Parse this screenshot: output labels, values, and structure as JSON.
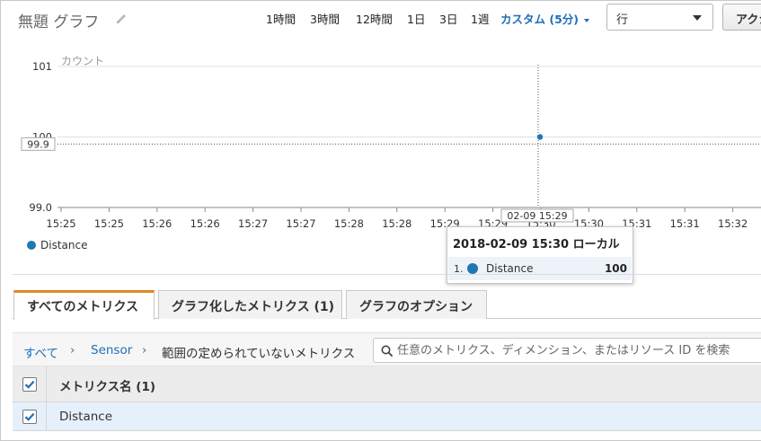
{
  "header": {
    "title": "無題 グラフ",
    "time_ranges": [
      "1時間",
      "3時間",
      "12時間",
      "1日",
      "3日",
      "1週"
    ],
    "custom_range": "カスタム (5分)",
    "view_select": "行",
    "actions_label": "アクション"
  },
  "chart_data": {
    "type": "line",
    "ylabel": "カウント",
    "ylim": [
      99.0,
      101
    ],
    "y_ticks": [
      "101",
      "100",
      "99.0"
    ],
    "x_ticks": [
      "15:25",
      "15:25",
      "15:26",
      "15:26",
      "15:27",
      "15:27",
      "15:28",
      "15:28",
      "15:29",
      "15:29",
      "15:30",
      "15:30",
      "15:31",
      "15:31",
      "15:32"
    ],
    "series": [
      {
        "name": "Distance",
        "color": "#1f77b4",
        "points": [
          {
            "x": "2018-02-09 15:30",
            "y": 100
          }
        ]
      }
    ],
    "crosshair": {
      "x_label": "02-09 15:29",
      "y_label": "99.9"
    },
    "grid": true,
    "legend": "bottom-left"
  },
  "tooltip": {
    "header": "2018-02-09 15:30 ローカル",
    "rows": [
      {
        "index": "1.",
        "name": "Distance",
        "value": "100",
        "color": "#1f77b4"
      }
    ]
  },
  "tabs": [
    {
      "label": "すべてのメトリクス",
      "active": true
    },
    {
      "label": "グラフ化したメトリクス (1)",
      "active": false
    },
    {
      "label": "グラフのオプション",
      "active": false
    }
  ],
  "breadcrumb": {
    "all": "すべて",
    "sensor": "Sensor",
    "current": "範囲の定められていないメトリクス"
  },
  "search": {
    "placeholder": "任意のメトリクス、ディメンション、またはリソース ID を検索"
  },
  "table": {
    "header": "メトリクス名 (1)",
    "rows": [
      {
        "name": "Distance",
        "checked": true
      }
    ]
  },
  "colors": {
    "accent": "#1f6fb8",
    "tab_active": "#e0892b",
    "series": "#1f77b4",
    "row_selected": "#e6f0fa"
  }
}
